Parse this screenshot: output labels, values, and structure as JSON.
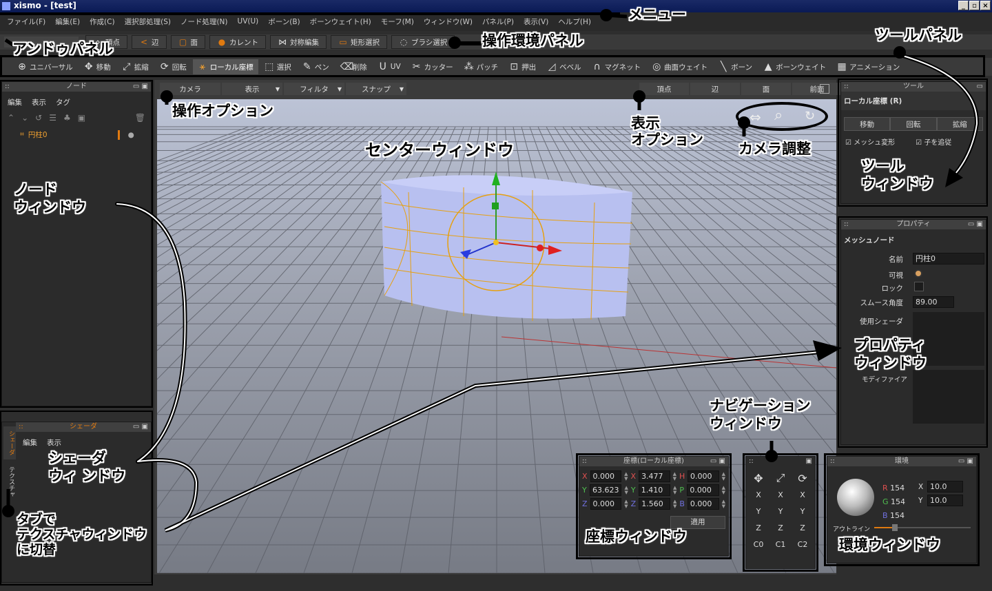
{
  "window": {
    "title": "xismo - [test]",
    "buttons": [
      "_",
      "▫",
      "×"
    ]
  },
  "menu": [
    "ファイル(F)",
    "編集(E)",
    "作成(C)",
    "選択部処理(S)",
    "ノード処理(N)",
    "UV(U)",
    "ボーン(B)",
    "ボーンウェイト(H)",
    "モーフ(M)",
    "ウィンドウ(W)",
    "パネル(P)",
    "表示(V)",
    "ヘルプ(H)"
  ],
  "env_panel": [
    "頂点",
    "辺",
    "面",
    "カレント",
    "対称編集",
    "矩形選択",
    "ブラシ選択"
  ],
  "tools": [
    "ユニバーサル",
    "移動",
    "拡縮",
    "回転",
    "ローカル座標",
    "選択",
    "ペン",
    "削除",
    "UV",
    "カッター",
    "パッチ",
    "押出",
    "ベベル",
    "マグネット",
    "曲面ウェイト",
    "ボーン",
    "ボーンウェイト",
    "アニメーション"
  ],
  "op_options": [
    "カメラ",
    "表示",
    "フィルタ",
    "スナップ"
  ],
  "display_options": [
    "頂点",
    "辺",
    "面",
    "前面"
  ],
  "node_window": {
    "title": "ノード",
    "menu": [
      "編集",
      "表示",
      "タグ"
    ],
    "item": "円柱0"
  },
  "shader_window": {
    "title": "シェーダ",
    "menu": [
      "編集",
      "表示"
    ],
    "tabs": [
      "シェーダ",
      "テクスチャ"
    ]
  },
  "tool_window": {
    "title": "ツール",
    "mode": "ローカル座標 (R)",
    "buttons": [
      "移動",
      "回転",
      "拡縮"
    ],
    "checks": [
      "メッシュ変形",
      "子を追従"
    ]
  },
  "property_window": {
    "title": "プロパティ",
    "section": "メッシュノード",
    "name_label": "名前",
    "name_value": "円柱0",
    "visible_label": "可視",
    "lock_label": "ロック",
    "smooth_label": "スムース角度",
    "smooth_value": "89.00",
    "shader_label": "使用シェーダ",
    "modifier_label": "モディファイア"
  },
  "coord_window": {
    "title": "座標(ローカル座標)",
    "rows": [
      [
        {
          "k": "X",
          "v": "0.000"
        },
        {
          "k": "X",
          "v": "3.477"
        },
        {
          "k": "H",
          "v": "0.000"
        }
      ],
      [
        {
          "k": "Y",
          "v": "63.623"
        },
        {
          "k": "Y",
          "v": "1.410"
        },
        {
          "k": "P",
          "v": "0.000"
        }
      ],
      [
        {
          "k": "Z",
          "v": "0.000"
        },
        {
          "k": "Z",
          "v": "1.560"
        },
        {
          "k": "B",
          "v": "0.000"
        }
      ]
    ],
    "apply": "適用"
  },
  "nav_window": {
    "rows": [
      [
        "X",
        "X",
        "X"
      ],
      [
        "Y",
        "Y",
        "Y"
      ],
      [
        "Z",
        "Z",
        "Z"
      ],
      [
        "C0",
        "C1",
        "C2"
      ]
    ]
  },
  "env_window": {
    "title": "環境",
    "r_label": "R",
    "r": "154",
    "g_label": "G",
    "g": "154",
    "b_label": "B",
    "b": "154",
    "x_label": "X",
    "x": "10.0",
    "y_label": "Y",
    "y": "10.0",
    "outline": "アウトライン"
  },
  "callouts": {
    "menu": "メニュー",
    "undo": "アンドゥパネル",
    "env": "操作環境パネル",
    "tool_panel": "ツールパネル",
    "op_opt": "操作オプション",
    "disp_opt1": "表示",
    "disp_opt2": "オプション",
    "camera": "カメラ調整",
    "center": "センターウィンドウ",
    "node1": "ノード",
    "node2": "ウィンドウ",
    "toolw1": "ツール",
    "toolw2": "ウィンドウ",
    "prop1": "プロパティ",
    "prop2": "ウィンドウ",
    "nav1": "ナビゲーション",
    "nav2": "ウィンドウ",
    "shader1": "シェーダ",
    "shader2": "ウィ ンドウ",
    "tab1": "タブで",
    "tab2": "テクスチャウィンドウ",
    "tab3": "に切替",
    "coord": "座標ウィンドウ",
    "envw": "環境ウィンドウ"
  },
  "colors": {
    "accent": "#e07a10",
    "viewport_top": "#b9c0d4",
    "viewport_bottom": "#6d717d",
    "mesh": "#b8c0f0"
  }
}
